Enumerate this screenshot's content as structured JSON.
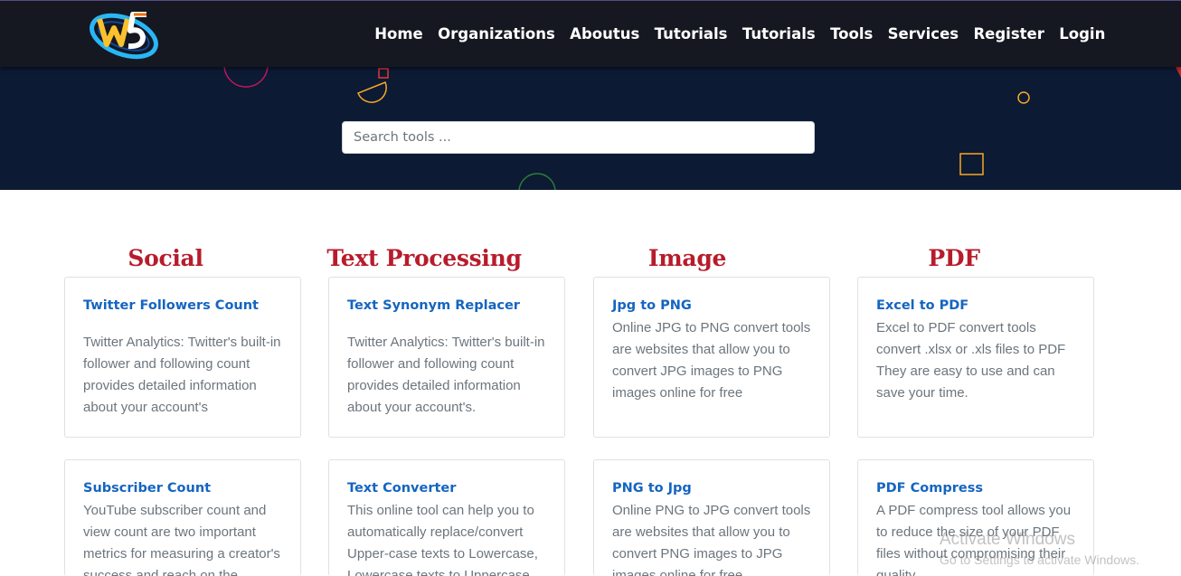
{
  "nav": {
    "items": [
      "Home",
      "Organizations",
      "Aboutus",
      "Tutorials",
      "Tutorials",
      "Tools",
      "Services",
      "Register",
      "Login"
    ]
  },
  "search": {
    "placeholder": "Search tools ..."
  },
  "categories": [
    {
      "heading": "Social",
      "cards": [
        {
          "title": "Twitter Followers Count",
          "desc": "Twitter Analytics: Twitter's built-in follower and following count provides detailed information about your account's"
        },
        {
          "title": "Subscriber Count",
          "desc": "YouTube subscriber count and view count are two important metrics for measuring a creator's success and reach on the"
        }
      ]
    },
    {
      "heading": "Text Processing",
      "cards": [
        {
          "title": "Text Synonym Replacer",
          "desc": "Twitter Analytics: Twitter's built-in follower and following count provides detailed information about your account's."
        },
        {
          "title": "Text Converter",
          "desc": "This online tool can help you to automatically replace/convert Upper-case texts to Lowercase, Lowercase texts to Uppercase"
        }
      ]
    },
    {
      "heading": "Image",
      "cards": [
        {
          "title": "Jpg to PNG",
          "desc": "Online JPG to PNG convert tools are websites that allow you to convert JPG images to PNG images online for free"
        },
        {
          "title": "PNG to Jpg",
          "desc": "Online PNG to JPG convert tools are websites that allow you to convert PNG images to JPG images online for free"
        }
      ]
    },
    {
      "heading": "PDF",
      "cards": [
        {
          "title": "Excel to PDF",
          "desc": "Excel to PDF convert tools convert .xlsx or .xls files to PDF They are easy to use and can save your time."
        },
        {
          "title": "PDF Compress",
          "desc": "A PDF compress tool allows you to reduce the size of your PDF files without compromising their quality"
        }
      ]
    }
  ],
  "watermark": {
    "line1": "Activate Windows",
    "line2": "Go to Settings to activate Windows."
  },
  "colors": {
    "navbar": "#151821",
    "hero": "#0c1a34",
    "heading": "#b71c2c",
    "card_title": "#1565c0",
    "card_text": "#6c757d"
  }
}
